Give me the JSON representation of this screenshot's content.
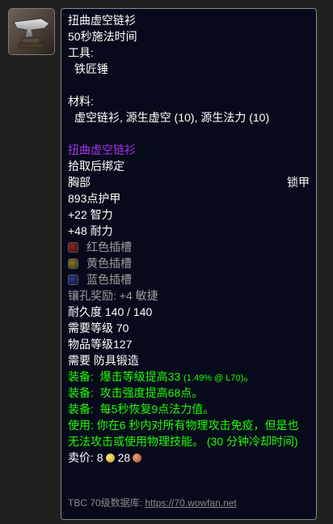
{
  "item": {
    "icon": "anvil-icon",
    "recipe_name": "扭曲虚空链衫",
    "cast_time": "50秒施法时间",
    "tools_label": "工具:",
    "tool": "铁匠锤",
    "reagents_label": "材料:",
    "reagents": "虚空链衫, 源生虚空 (10), 源生法力 (10)",
    "result_name": "扭曲虚空链衫",
    "binding": "拾取后绑定",
    "slot": "胸部",
    "armor_type": "锁甲",
    "armor": "893点护甲",
    "stats": [
      "+22 智力",
      "+48 耐力"
    ],
    "sockets": [
      {
        "label": "红色插槽",
        "color": "red"
      },
      {
        "label": "黄色插槽",
        "color": "yellow"
      },
      {
        "label": "蓝色插槽",
        "color": "blue"
      }
    ],
    "socket_bonus": "镶孔奖励: +4 敏捷",
    "durability": "耐久度 140 / 140",
    "required_level": "需要等级 70",
    "item_level": "物品等级127",
    "requires_skill": "需要 防具锻造",
    "equip_effects": [
      {
        "prefix": "装备:",
        "text": "爆击等级提高33",
        "note": "(1.49% @ L70)",
        "suffix": "。"
      },
      {
        "prefix": "装备:",
        "text": "攻击强度提高68点。"
      },
      {
        "prefix": "装备:",
        "text": "每5秒恢复9点法力值。"
      }
    ],
    "use_effect": "使用: 你在6 秒内对所有物理攻击免疫，但是也无法攻击或使用物理技能。 (30 分钟冷却时间)",
    "sell_label": "卖价:",
    "sell_gold": "8",
    "sell_copper": "28"
  },
  "footer": {
    "label": "TBC 70级数据库:",
    "link": "https://70.wowfan.net"
  },
  "colors": {
    "epic": "#a335ee",
    "uncommon_green": "#1eff00",
    "gray": "#9d9d9d",
    "background": "#070a1a"
  }
}
